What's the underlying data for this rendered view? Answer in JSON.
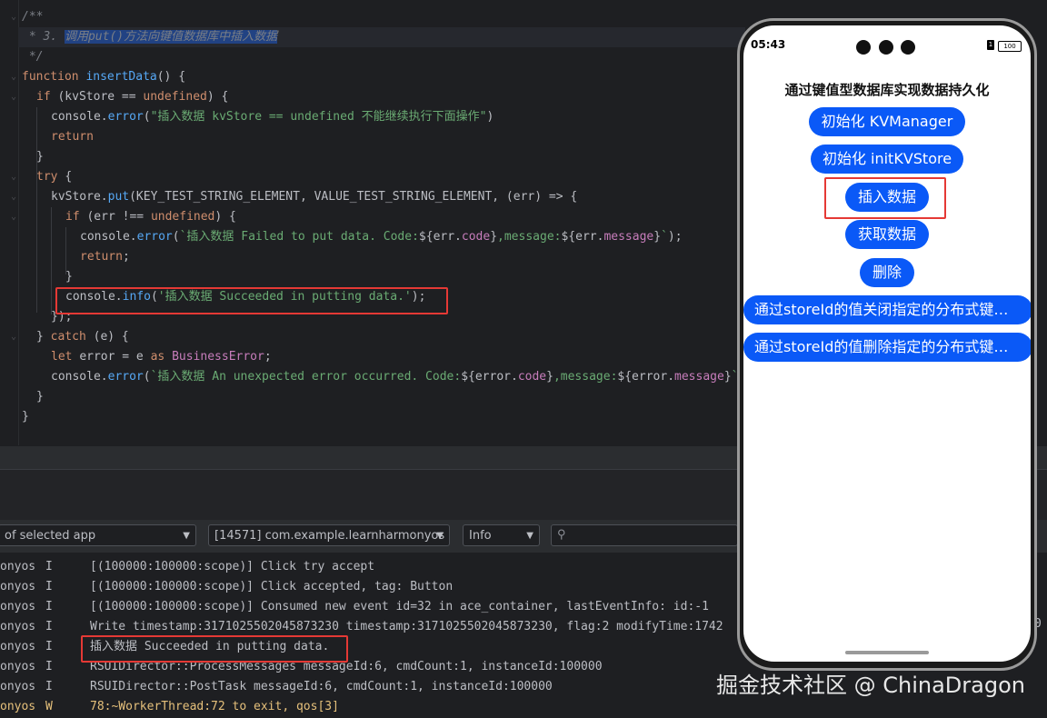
{
  "editor": {
    "lines": [
      {
        "indent": 0,
        "html": "<span class='cmt'>/**</span>"
      },
      {
        "indent": 0,
        "html": "<span class='cmt'> * 3. </span><span class='cmt hl-sel'>调用put()方法向键值数据库中插入数据</span>"
      },
      {
        "indent": 0,
        "html": "<span class='cmt'> */</span>"
      },
      {
        "indent": 0,
        "html": "<span class='kw'>function </span><span class='fn'>insertData</span><span class='plain'>() {</span>"
      },
      {
        "indent": 1,
        "html": "<span class='kw'>if </span><span class='plain'>(kvStore == </span><span class='kw'>undefined</span><span class='plain'>) {</span>"
      },
      {
        "indent": 2,
        "html": "<span class='plain'>console.</span><span class='mth'>error</span><span class='plain'>(</span><span class='str'>\"插入数据 kvStore == undefined 不能继续执行下面操作\"</span><span class='plain'>)</span>"
      },
      {
        "indent": 2,
        "html": "<span class='kw'>return</span>"
      },
      {
        "indent": 1,
        "html": "<span class='plain'>}</span>"
      },
      {
        "indent": 1,
        "html": "<span class='kw'>try </span><span class='plain'>{</span>"
      },
      {
        "indent": 2,
        "html": "<span class='plain'>kvStore.</span><span class='mth'>put</span><span class='plain'>(KEY_TEST_STRING_ELEMENT, VALUE_TEST_STRING_ELEMENT, (err) =&gt; {</span>"
      },
      {
        "indent": 3,
        "html": "<span class='kw'>if </span><span class='plain'>(err !== </span><span class='kw'>undefined</span><span class='plain'>) {</span>"
      },
      {
        "indent": 4,
        "html": "<span class='plain'>console.</span><span class='mth'>error</span><span class='plain'>(</span><span class='str'>`插入数据 Failed to put data. Code:</span><span class='plain'>${err.</span><span class='prop'>code</span><span class='plain'>}</span><span class='str'>,message:</span><span class='plain'>${err.</span><span class='prop'>message</span><span class='plain'>}</span><span class='str'>`</span><span class='plain'>);</span>"
      },
      {
        "indent": 4,
        "html": "<span class='kw'>return</span><span class='plain'>;</span>"
      },
      {
        "indent": 3,
        "html": "<span class='plain'>}</span>"
      },
      {
        "indent": 3,
        "html": "<span class='plain'>console.</span><span class='mth'>info</span><span class='plain'>(</span><span class='str'>'插入数据 Succeeded in putting data.'</span><span class='plain'>);</span>"
      },
      {
        "indent": 2,
        "html": "<span class='plain'>});</span>"
      },
      {
        "indent": 1,
        "html": "<span class='plain'>} </span><span class='kw'>catch </span><span class='plain'>(e) {</span>"
      },
      {
        "indent": 2,
        "html": "<span class='kw'>let </span><span class='plain'>error = e </span><span class='kw'>as </span><span class='typ'>BusinessError</span><span class='plain'>;</span>"
      },
      {
        "indent": 2,
        "html": "<span class='plain'>console.</span><span class='mth'>error</span><span class='plain'>(</span><span class='str'>`插入数据 An unexpected error occurred. Code:</span><span class='plain'>${error.</span><span class='prop'>code</span><span class='plain'>}</span><span class='str'>,message:</span><span class='plain'>${error.</span><span class='prop'>message</span><span class='plain'>}</span><span class='str'>`</span><span class='plain'>);</span>"
      },
      {
        "indent": 1,
        "html": "<span class='plain'>}</span>"
      },
      {
        "indent": 0,
        "html": "<span class='plain'>}</span>"
      }
    ]
  },
  "logcat": {
    "app_filter": "of selected app",
    "process": "[14571] com.example.learnharmonyos",
    "level": "Info",
    "search_placeholder": "",
    "rows": [
      {
        "tag": "onyos",
        "level": "I",
        "msg": "[(100000:100000:scope)] Click try accept"
      },
      {
        "tag": "onyos",
        "level": "I",
        "msg": "[(100000:100000:scope)] Click accepted, tag: Button"
      },
      {
        "tag": "onyos",
        "level": "I",
        "msg": "[(100000:100000:scope)] Consumed new event id=32 in ace_container, lastEventInfo: id:-1"
      },
      {
        "tag": "onyos",
        "level": "I",
        "msg": "Write timestamp:3171025502045873230 timestamp:3171025502045873230, flag:2 modifyTime:1742"
      },
      {
        "tag": "onyos",
        "level": "I",
        "msg": "插入数据 Succeeded in putting data."
      },
      {
        "tag": "onyos",
        "level": "I",
        "msg": "RSUIDirector::ProcessMessages messageId:6, cmdCount:1, instanceId:100000"
      },
      {
        "tag": "onyos",
        "level": "I",
        "msg": "RSUIDirector::PostTask messageId:6, cmdCount:1, instanceId:100000"
      },
      {
        "tag": "onyos",
        "level": "W",
        "msg": "78:~WorkerThread:72 to exit, qos[3]"
      }
    ],
    "overflow_char": "0"
  },
  "phone": {
    "time": "05:43",
    "battery": "100",
    "title": "通过键值型数据库实现数据持久化",
    "buttons": [
      {
        "label": "初始化 KVManager"
      },
      {
        "label": "初始化 initKVStore"
      },
      {
        "label": "插入数据"
      },
      {
        "label": "获取数据"
      },
      {
        "label": "删除"
      },
      {
        "label": "通过storeId的值关闭指定的分布式键值数据库"
      },
      {
        "label": "通过storeId的值删除指定的分布式键值数据库"
      }
    ]
  },
  "watermark": "掘金技术社区 @ ChinaDragon",
  "colors": {
    "accent": "#0a59f7",
    "highlight_box": "#e53935",
    "editor_bg": "#1e1f22"
  }
}
